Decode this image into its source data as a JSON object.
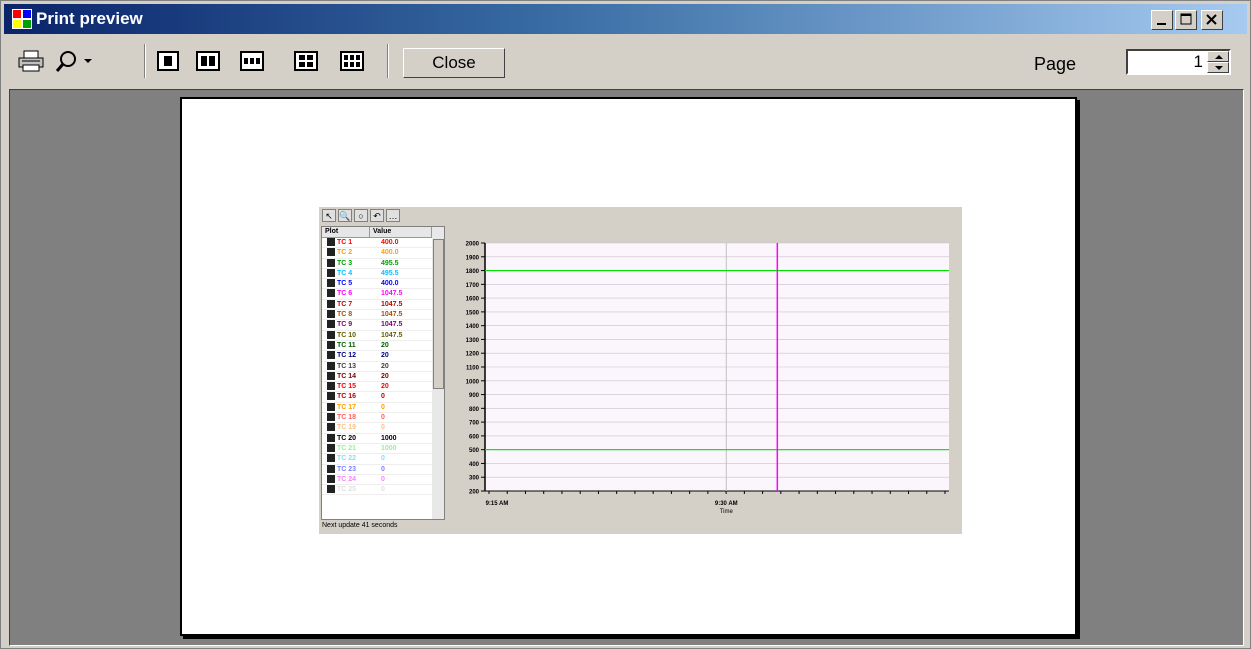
{
  "window": {
    "title": "Print preview"
  },
  "toolbar": {
    "close_label": "Close",
    "page_label": "Page",
    "page_value": "1",
    "icons": [
      "printer-icon",
      "zoom-icon",
      "zoom-dropdown-icon",
      "one-page-icon",
      "two-pages-icon",
      "three-pages-icon",
      "four-pages-icon",
      "six-pages-icon"
    ]
  },
  "preview": {
    "mini_toolbar": [
      "↖",
      "🔍",
      "○",
      "↶",
      "…"
    ],
    "table_headers": [
      "Plot",
      "Value"
    ],
    "rows": [
      {
        "name": "TC 1",
        "value": "400.0",
        "color": "#ff0000"
      },
      {
        "name": "TC 2",
        "value": "400.0",
        "color": "#ffa000"
      },
      {
        "name": "TC 3",
        "value": "495.5",
        "color": "#00a000"
      },
      {
        "name": "TC 4",
        "value": "495.5",
        "color": "#00c0ff"
      },
      {
        "name": "TC 5",
        "value": "400.0",
        "color": "#0000ff"
      },
      {
        "name": "TC 6",
        "value": "1047.5",
        "color": "#ff00ff"
      },
      {
        "name": "TC 7",
        "value": "1047.5",
        "color": "#c00000"
      },
      {
        "name": "TC 8",
        "value": "1047.5",
        "color": "#a05000"
      },
      {
        "name": "TC 9",
        "value": "1047.5",
        "color": "#800080"
      },
      {
        "name": "TC 10",
        "value": "1047.5",
        "color": "#606000"
      },
      {
        "name": "TC 11",
        "value": "20",
        "color": "#006000"
      },
      {
        "name": "TC 12",
        "value": "20",
        "color": "#000080"
      },
      {
        "name": "TC 13",
        "value": "20",
        "color": "#404040"
      },
      {
        "name": "TC 14",
        "value": "20",
        "color": "#800000"
      },
      {
        "name": "TC 15",
        "value": "20",
        "color": "#ff0000"
      },
      {
        "name": "TC 16",
        "value": "0",
        "color": "#c00000"
      },
      {
        "name": "TC 17",
        "value": "0",
        "color": "#ffa000"
      },
      {
        "name": "TC 18",
        "value": "0",
        "color": "#ff6060"
      },
      {
        "name": "TC 19",
        "value": "0",
        "color": "#ffc080"
      },
      {
        "name": "TC 20",
        "value": "1000",
        "color": "#000000"
      },
      {
        "name": "TC 21",
        "value": "1000",
        "color": "#80ff80"
      },
      {
        "name": "TC 22",
        "value": "0",
        "color": "#80e0ff"
      },
      {
        "name": "TC 23",
        "value": "0",
        "color": "#8080ff"
      },
      {
        "name": "TC 24",
        "value": "0",
        "color": "#ff80ff"
      },
      {
        "name": "TC 25",
        "value": "0",
        "color": "#e0e0e0"
      }
    ],
    "status": "Next update 41 seconds"
  },
  "chart_data": {
    "type": "line",
    "title": "",
    "xlabel": "Time",
    "ylabel": "",
    "y_ticks": [
      2000,
      1900,
      1800,
      1700,
      1600,
      1500,
      1400,
      1300,
      1200,
      1100,
      1000,
      900,
      800,
      700,
      600,
      500,
      400,
      300,
      200
    ],
    "ylim": [
      200,
      2000
    ],
    "x_tick_labels": [
      "9:15 AM",
      "9:30 AM"
    ],
    "series": [
      {
        "values": [
          1800,
          1800
        ],
        "color": "#00e000"
      },
      {
        "values": [
          500,
          500
        ],
        "color": "#00e000"
      }
    ],
    "cursor_x_fraction": 0.63,
    "cursor_color": "#ff00ff"
  }
}
